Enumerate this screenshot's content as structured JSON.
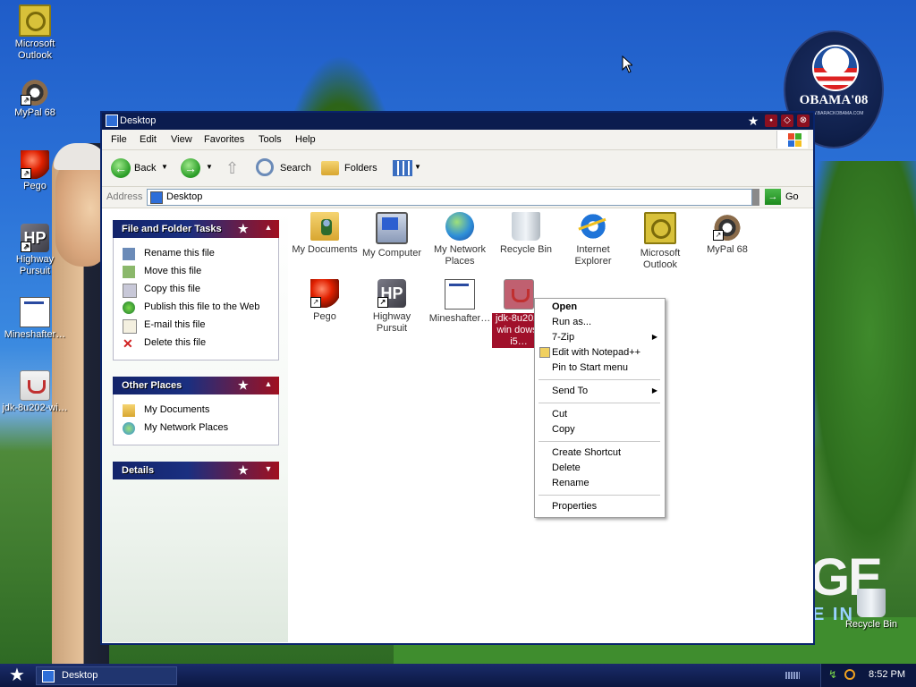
{
  "desktop": {
    "icons": [
      {
        "label": "Microsoft Outlook",
        "icon": "outlook-icon"
      },
      {
        "label": "MyPal 68",
        "icon": "mypal-icon"
      },
      {
        "label": "Pego",
        "icon": "pego-icon"
      },
      {
        "label": "Highway Pursuit",
        "icon": "highway-pursuit-icon"
      },
      {
        "label": "Mineshafter…",
        "icon": "mineshafter-icon"
      },
      {
        "label": "jdk-8u202-wi…",
        "icon": "java-installer-icon"
      },
      {
        "label": "Recycle Bin",
        "icon": "recycle-bin-icon"
      }
    ],
    "wallpaper": {
      "badge_text": "OBAMA'08",
      "badge_sub": "WWW.BARACKOBAMA.COM",
      "big_text": "GE",
      "big_text2": "E IN"
    }
  },
  "window": {
    "title": "Desktop",
    "menu": [
      "File",
      "Edit",
      "View",
      "Favorites",
      "Tools",
      "Help"
    ],
    "toolbar": {
      "back": "Back",
      "search": "Search",
      "folders": "Folders"
    },
    "address": {
      "label": "Address",
      "value": "Desktop",
      "go": "Go"
    },
    "tasks": {
      "file_folder_title": "File and Folder Tasks",
      "file_folder_items": [
        "Rename this file",
        "Move this file",
        "Copy this file",
        "Publish this file to the Web",
        "E-mail this file",
        "Delete this file"
      ],
      "other_places_title": "Other Places",
      "other_places_items": [
        "My Documents",
        "My Network Places"
      ],
      "details_title": "Details"
    },
    "items": [
      {
        "label": "My Documents",
        "icon": "my-documents-icon"
      },
      {
        "label": "My Computer",
        "icon": "my-computer-icon"
      },
      {
        "label": "My Network Places",
        "icon": "network-places-icon"
      },
      {
        "label": "Recycle Bin",
        "icon": "recycle-bin-icon"
      },
      {
        "label": "Internet Explorer",
        "icon": "internet-explorer-icon"
      },
      {
        "label": "Microsoft Outlook",
        "icon": "outlook-icon"
      },
      {
        "label": "MyPal 68",
        "icon": "mypal-icon"
      },
      {
        "label": "Pego",
        "icon": "pego-icon"
      },
      {
        "label": "Highway Pursuit",
        "icon": "highway-pursuit-icon"
      },
      {
        "label": "Mineshafter…",
        "icon": "mineshafter-icon"
      },
      {
        "label": "jdk-8u202-win dows-i5…",
        "icon": "java-installer-icon"
      }
    ]
  },
  "context_menu": {
    "items": [
      "Open",
      "Run as...",
      "7-Zip",
      "Edit with Notepad++",
      "Pin to Start menu",
      "Send To",
      "Cut",
      "Copy",
      "Create Shortcut",
      "Delete",
      "Rename",
      "Properties"
    ]
  },
  "taskbar": {
    "task_label": "Desktop",
    "clock": "8:52 PM"
  },
  "colors": {
    "selection": "#a0102a",
    "titlebar": "#0b1c4f",
    "taskbar": "#0b1740"
  }
}
